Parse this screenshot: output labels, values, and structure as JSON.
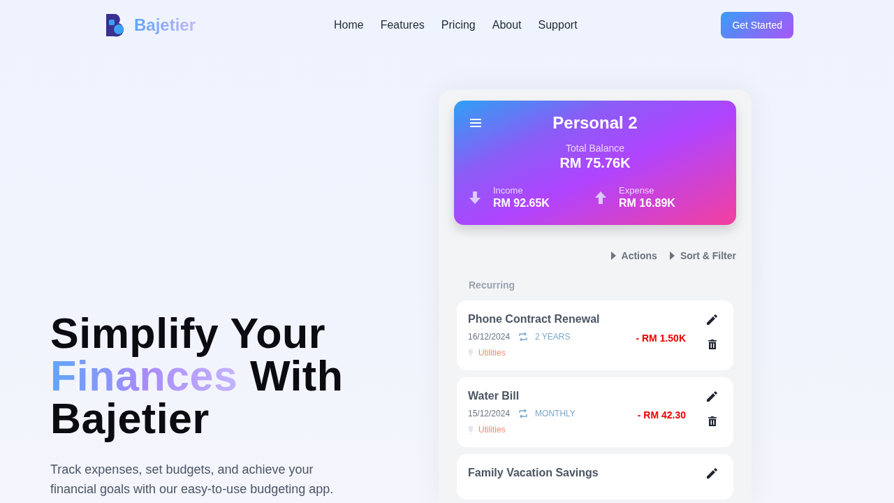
{
  "nav": {
    "brand": "Bajetier",
    "links": [
      "Home",
      "Features",
      "Pricing",
      "About",
      "Support"
    ],
    "cta": "Get Started"
  },
  "hero": {
    "headline_start": "Simplify Your",
    "headline_highlight": "Finances",
    "headline_middle": "With",
    "headline_end": "Bajetier",
    "subtitle": "Track expenses, set budgets, and achieve your financial goals with our easy-to-use budgeting app."
  },
  "app": {
    "wallet": {
      "title": "Personal 2",
      "balance_label": "Total Balance",
      "balance": "RM 75.76K",
      "income_label": "Income",
      "income": "RM 92.65K",
      "expense_label": "Expense",
      "expense": "RM 16.89K"
    },
    "toolbar": [
      "Actions",
      "Sort & Filter"
    ],
    "section": "Recurring",
    "transactions": [
      {
        "name": "Phone Contract Renewal",
        "date": "16/12/2024",
        "frequency": "2 YEARS",
        "category": "Utilities",
        "amount": "- RM 1.50K"
      },
      {
        "name": "Water Bill",
        "date": "15/12/2024",
        "frequency": "MONTHLY",
        "category": "Utilities",
        "amount": "- RM 42.30"
      },
      {
        "name": "Family Vacation Savings"
      }
    ]
  }
}
